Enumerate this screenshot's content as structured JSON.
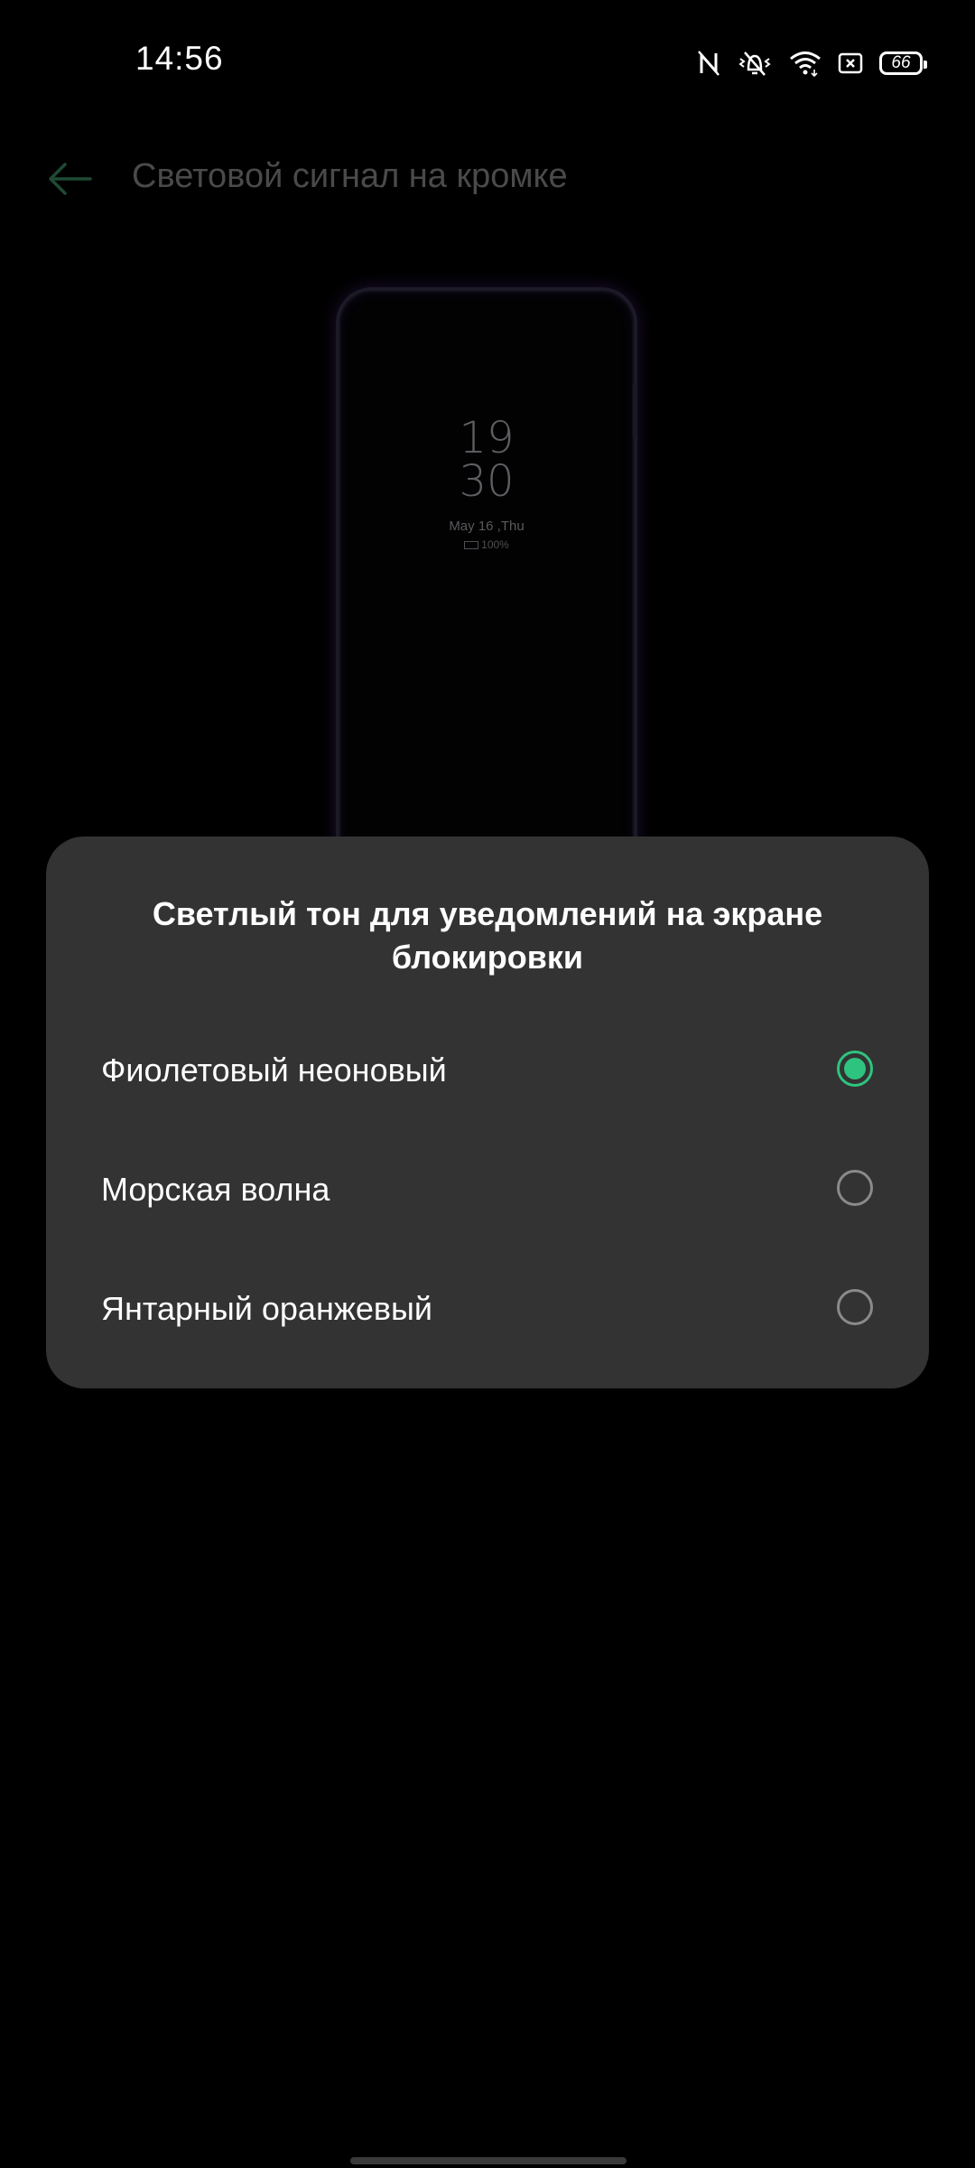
{
  "status_bar": {
    "time": "14:56",
    "battery_level": "66",
    "icons": [
      "nfc-icon",
      "vibrate-icon",
      "wifi-icon",
      "screen-record-icon",
      "battery-icon"
    ]
  },
  "header": {
    "back_icon": "arrow-left-icon",
    "title": "Световой сигнал на кромке"
  },
  "preview": {
    "hour": "19",
    "minute": "30",
    "date": "May 16 ,Thu",
    "battery": "100%"
  },
  "dialog": {
    "title": "Светлый тон для уведомлений на экране блокировки",
    "options": [
      {
        "label": "Фиолетовый неоновый",
        "selected": true
      },
      {
        "label": "Морская волна",
        "selected": false
      },
      {
        "label": "Янтарный оранжевый",
        "selected": false
      }
    ],
    "accent_color": "#2ec37f"
  }
}
